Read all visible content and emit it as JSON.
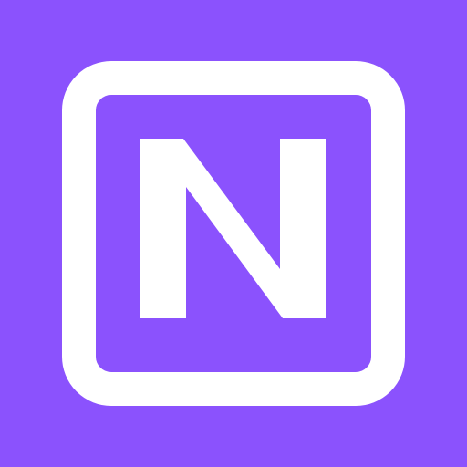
{
  "icon": {
    "name": "n-letter-app-icon",
    "logo_letter": "N",
    "colors": {
      "background": "#8B52FD",
      "foreground": "#FFFFFF"
    }
  }
}
